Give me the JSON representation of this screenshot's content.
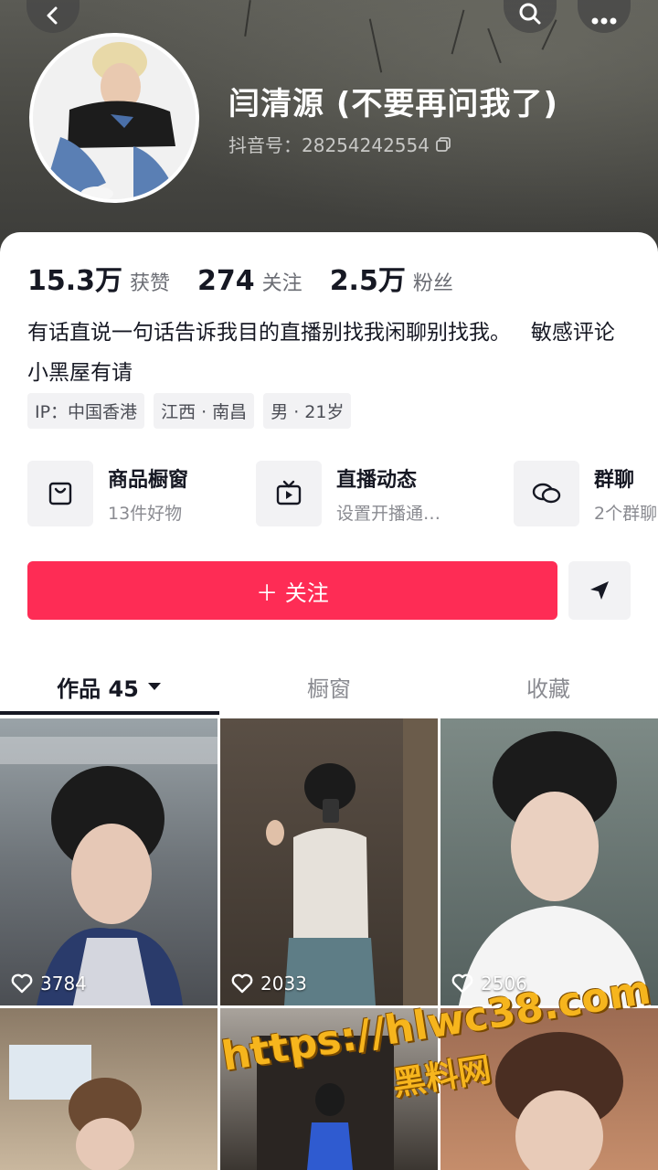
{
  "profile": {
    "nickname": "闫清源 (不要再问我了)",
    "douyin_id": "抖音号：28254242554"
  },
  "stats": [
    {
      "value": "15.3万",
      "label": "获赞"
    },
    {
      "value": "274",
      "label": "关注"
    },
    {
      "value": "2.5万",
      "label": "粉丝"
    }
  ],
  "bio": "有话直说一句话告诉我目的直播别找我闲聊别找我。   敏感评论小黑屋有请",
  "tags": [
    "IP：中国香港",
    "江西 · 南昌",
    "男 · 21岁"
  ],
  "features": [
    {
      "title": "商品橱窗",
      "subtitle": "13件好物",
      "icon": "shopping-bag-icon"
    },
    {
      "title": "直播动态",
      "subtitle": "设置开播通…",
      "icon": "tv-icon"
    },
    {
      "title": "群聊",
      "subtitle": "2个群聊",
      "icon": "chat-bubbles-icon"
    }
  ],
  "actions": {
    "follow_label": "＋ 关注"
  },
  "tabs": [
    {
      "label": "作品 45",
      "active": true
    },
    {
      "label": "橱窗",
      "active": false
    },
    {
      "label": "收藏",
      "active": false
    }
  ],
  "videos": [
    {
      "likes": "3784"
    },
    {
      "likes": "2033"
    },
    {
      "likes": "2506"
    },
    {
      "likes": ""
    },
    {
      "likes": ""
    },
    {
      "likes": ""
    }
  ],
  "watermark": {
    "url": "https://hlwc38.com",
    "name": "黑料网"
  },
  "colors": {
    "accent": "#fe2c55",
    "banner": "#4a4a45",
    "text_primary": "#161823",
    "text_secondary": "#8a8b91"
  }
}
